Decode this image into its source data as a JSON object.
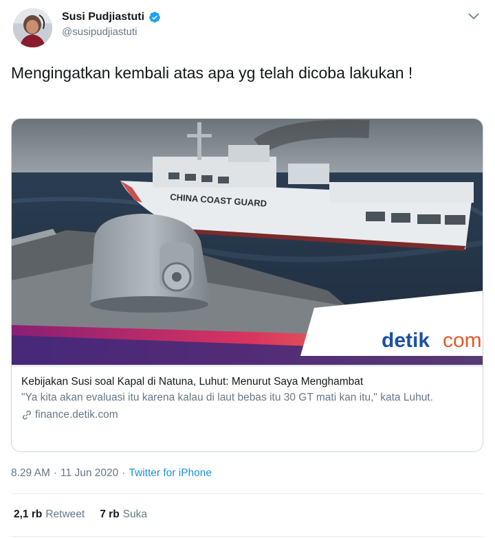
{
  "user": {
    "display_name": "Susi Pudjiastuti",
    "handle": "@susipudjiastuti",
    "verified": true
  },
  "tweet": {
    "text": "Mengingatkan kembali atas apa yg telah dicoba lakukan !"
  },
  "card": {
    "image_ship_text": "CHINA COAST GUARD",
    "image_logo_detik": "detik",
    "image_logo_com": "com",
    "title": "Kebijakan Susi soal Kapal di Natuna, Luhut: Menurut Saya Menghambat",
    "description": "\"Ya kita akan evaluasi itu karena kalau di laut bebas itu 30 GT mati kan itu,\" kata Luhut.",
    "domain": "finance.detik.com"
  },
  "meta": {
    "time": "8.29 AM",
    "separator": "·",
    "date": "11 Jun 2020",
    "source": "Twitter for iPhone"
  },
  "stats": {
    "retweets_value": "2,1 rb",
    "retweets_label": "Retweet",
    "likes_value": "7 rb",
    "likes_label": "Suka"
  },
  "colors": {
    "verified": "#1da1f2",
    "link": "#1b95e0",
    "secondary_text": "#657786",
    "border": "#ccd6dd"
  },
  "icons": {
    "verified": "verified-badge-icon",
    "caret": "chevron-down-icon",
    "link": "link-icon"
  }
}
